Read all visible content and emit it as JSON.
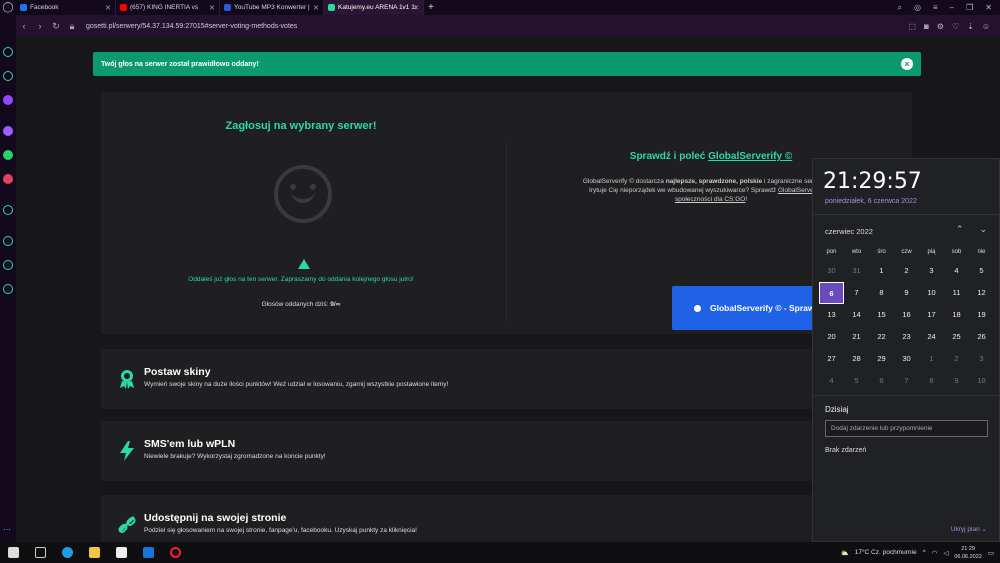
{
  "tabs": [
    {
      "label": "Facebook",
      "color": "#1877f2",
      "active": false
    },
    {
      "label": "(657) KING INERTIA vs ",
      "color": "#ff0000",
      "active": false
    },
    {
      "label": "YouTube MP3 Konwerter | ",
      "color": "#2a5bd7",
      "active": false
    },
    {
      "label": "Katujemy.eu ARENA 1v1 1:",
      "color": "#2ed8a1",
      "active": true
    }
  ],
  "address": {
    "url": "gosetti.pl/serwery/54.37.134.59:27015#server-voting-methods-votes"
  },
  "alert": {
    "text": "Twój głos na serwer został prawidłowo oddany!"
  },
  "vote": {
    "title": "Zagłosuj na wybrany serwer!",
    "warning": "Oddałeś już głos na ten serwer. Zapraszamy do oddania kolejnego głosu jutro!",
    "count_label": "Głosów oddanych dziś: ",
    "count_value": "9/∞"
  },
  "globalserverify": {
    "title_prefix": "Sprawdź i poleć ",
    "title_link": "GlobalServerify ©",
    "desc_a": "GlobalServerify © dostarcza ",
    "desc_bold": "najlepsze, sprawdzone, polskie",
    "desc_b": " i zagraniczne serwery bez",
    "desc_c": "Irytuje Cię nieporządek we wbudowanej wyszukiwarce? Sprawdź ",
    "desc_link1": "GlobalServerify © -",
    "desc_link2": "społeczności dla CS:GO",
    "desc_end": "!",
    "button": "GlobalServerify © - Sprawdź szczegóły"
  },
  "cards": [
    {
      "title": "Postaw skiny",
      "desc": "Wymień swoje skiny na duże ilości punktów! Weź udział w losowaniu, zgarnij wszystkie postawione itemy!",
      "icon": "award-icon"
    },
    {
      "title": "SMS'em lub wPLN",
      "desc": "Niewiele brakuje? Wykorzystaj zgromadzone na koncie punkty!",
      "icon": "bolt-icon"
    },
    {
      "title": "Udostępnij na swojej stronie",
      "desc": "Podziel się głosowaniem na swojej stronie, fanpage'u, facebooku. Uzyskaj punkty za kliknięcia!",
      "icon": "link-icon"
    }
  ],
  "calendar": {
    "time": "21:29:57",
    "date": "poniedziałek, 6 czerwca 2022",
    "month": "czerwiec 2022",
    "weekdays": [
      "pon",
      "wto",
      "śro",
      "czw",
      "pią",
      "sob",
      "nie"
    ],
    "days": [
      {
        "d": "30",
        "out": true
      },
      {
        "d": "31",
        "out": true
      },
      {
        "d": "1"
      },
      {
        "d": "2"
      },
      {
        "d": "3"
      },
      {
        "d": "4"
      },
      {
        "d": "5"
      },
      {
        "d": "6",
        "today": true
      },
      {
        "d": "7"
      },
      {
        "d": "8"
      },
      {
        "d": "9"
      },
      {
        "d": "10"
      },
      {
        "d": "11"
      },
      {
        "d": "12"
      },
      {
        "d": "13"
      },
      {
        "d": "14"
      },
      {
        "d": "15"
      },
      {
        "d": "16"
      },
      {
        "d": "17"
      },
      {
        "d": "18"
      },
      {
        "d": "19"
      },
      {
        "d": "20"
      },
      {
        "d": "21"
      },
      {
        "d": "22"
      },
      {
        "d": "23"
      },
      {
        "d": "24"
      },
      {
        "d": "25"
      },
      {
        "d": "26"
      },
      {
        "d": "27"
      },
      {
        "d": "28"
      },
      {
        "d": "29"
      },
      {
        "d": "30"
      },
      {
        "d": "1",
        "out": true
      },
      {
        "d": "2",
        "out": true
      },
      {
        "d": "3",
        "out": true
      },
      {
        "d": "4",
        "out": true
      },
      {
        "d": "5",
        "out": true
      },
      {
        "d": "6",
        "out": true
      },
      {
        "d": "7",
        "out": true
      },
      {
        "d": "8",
        "out": true
      },
      {
        "d": "9",
        "out": true
      },
      {
        "d": "10",
        "out": true
      }
    ],
    "today_label": "Dzisiaj",
    "input_placeholder": "Dodaj zdarzenie lub przypomnienie",
    "no_events": "Brak zdarzeń",
    "hide_plan": "Ukryj plan"
  },
  "taskbar": {
    "weather": "17°C  Cz. pochmurnie",
    "time": "21:29",
    "date": "06.06.2022"
  }
}
